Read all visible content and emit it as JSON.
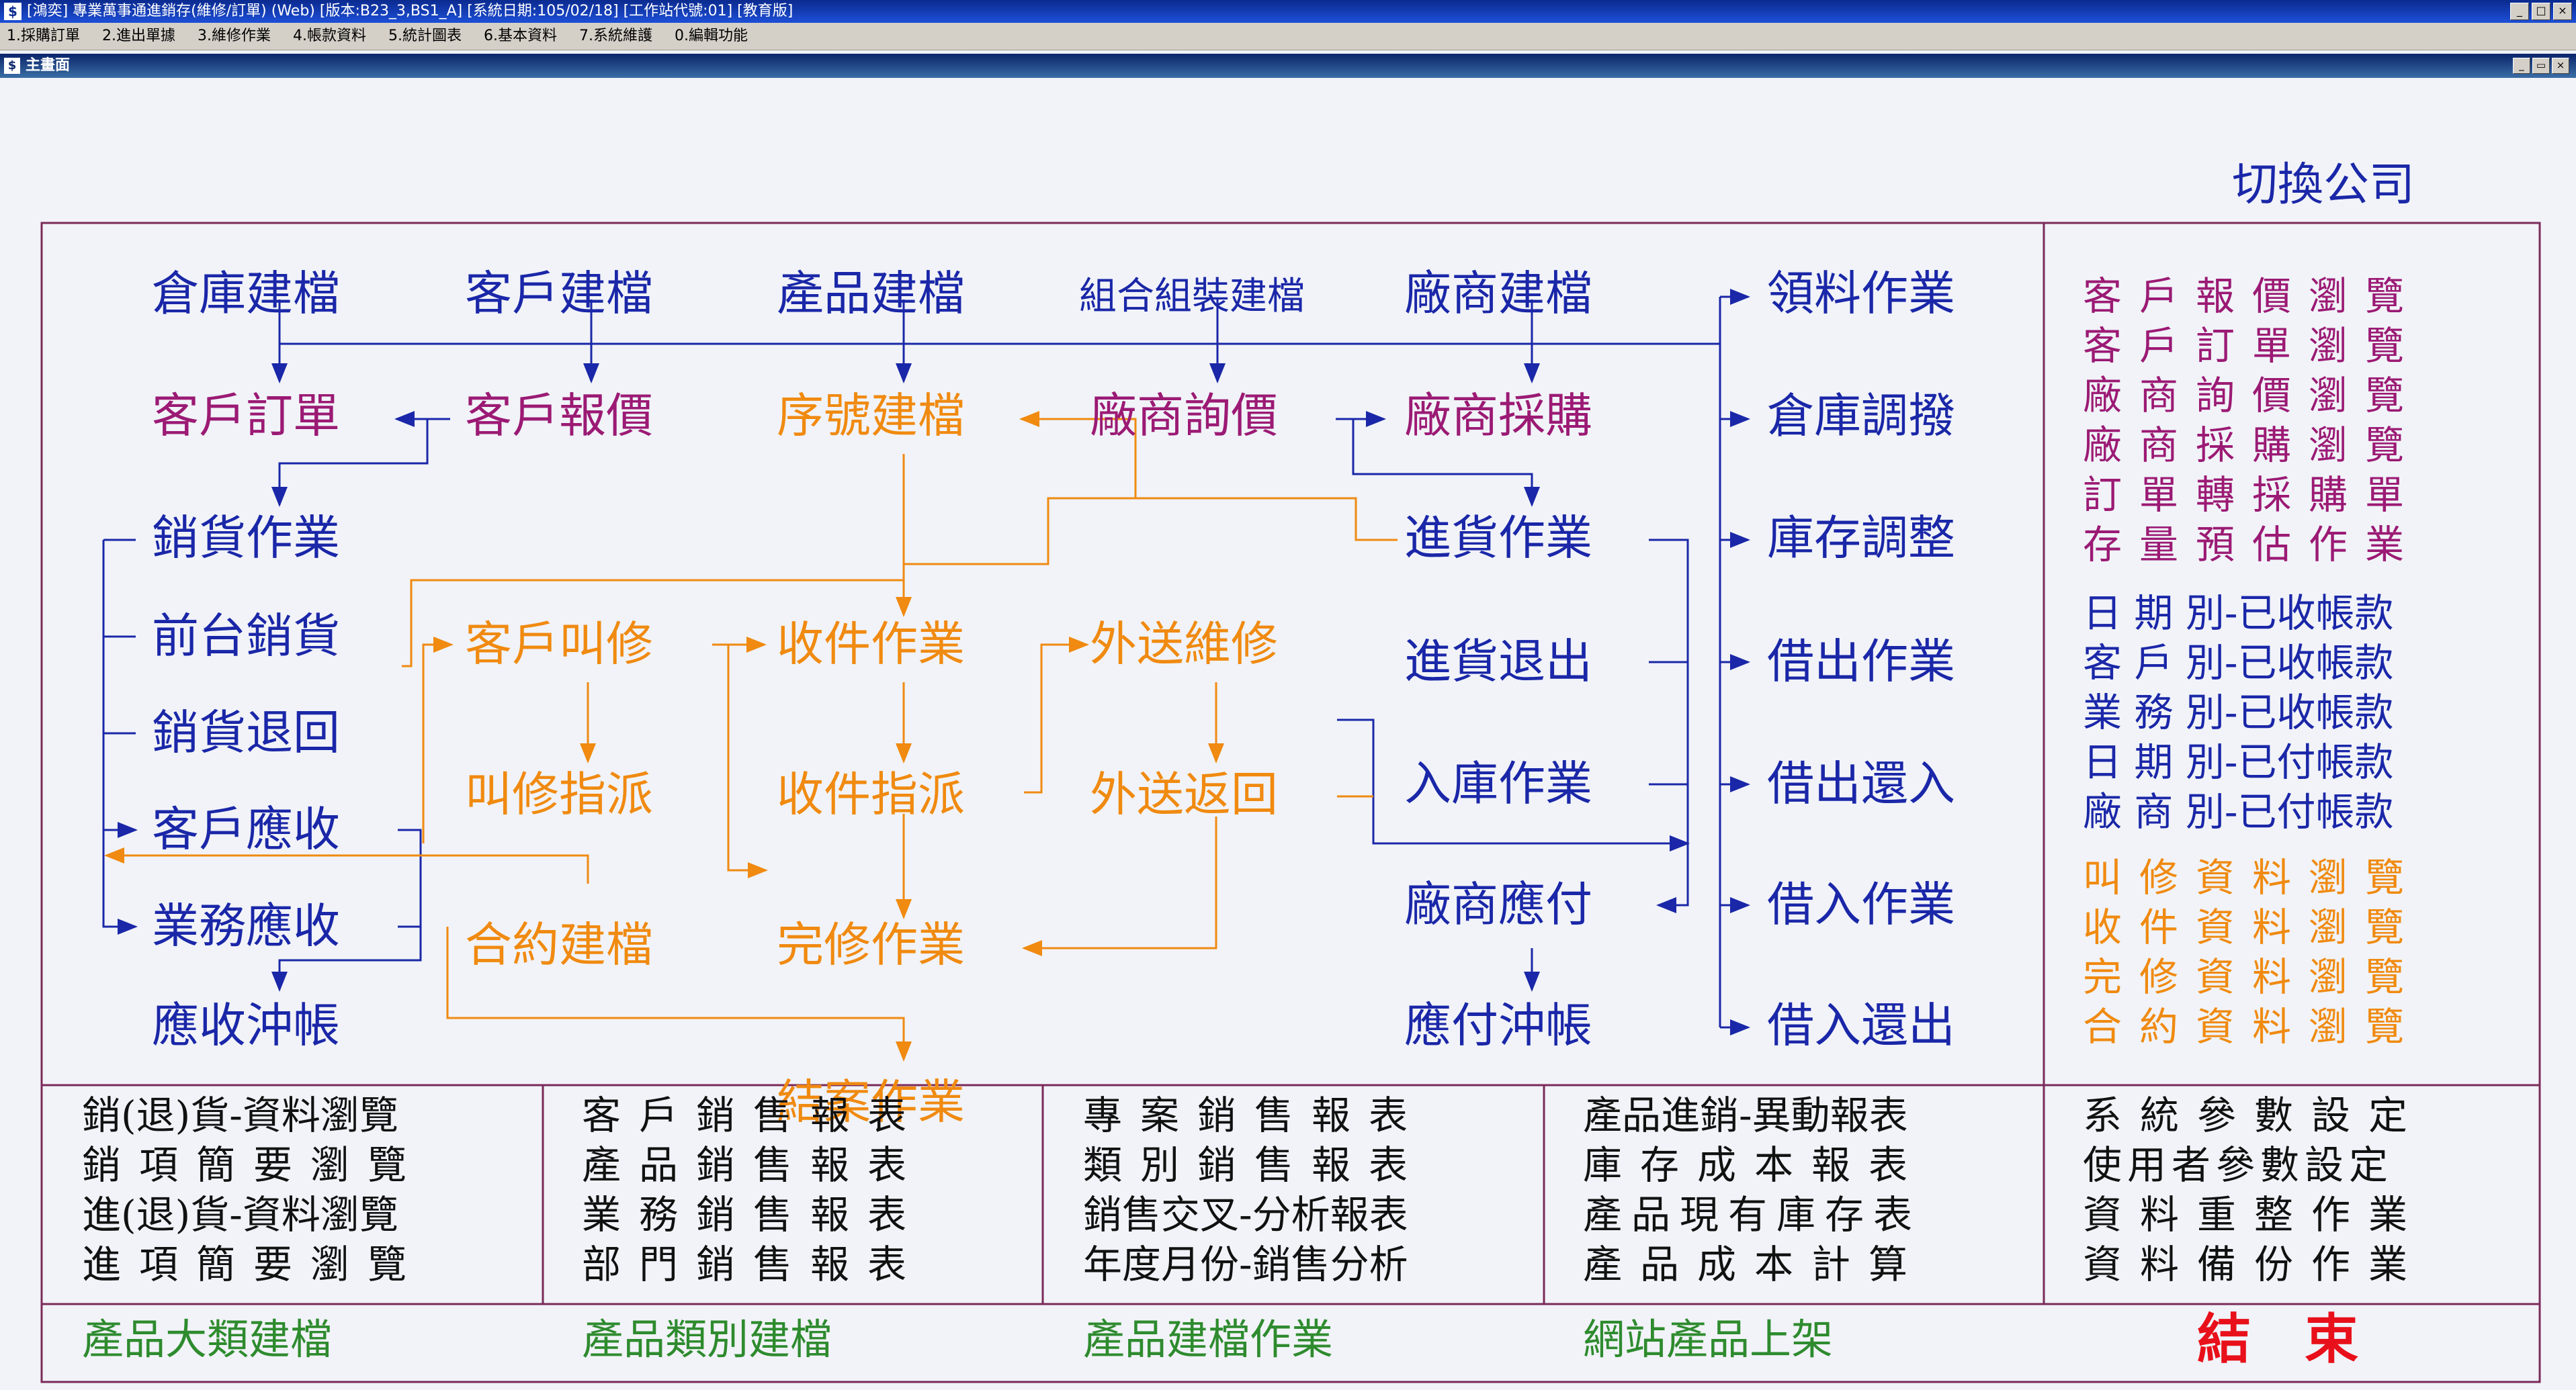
{
  "window": {
    "title": "[鴻奕] 專業萬事通進銷存(維修/訂單) (Web) [版本:B23_3,BS1_A] [系統日期:105/02/18] [工作站代號:01] [教育版]",
    "controls": [
      "_",
      "□",
      "×"
    ]
  },
  "menu": [
    "1.採購訂單",
    "2.進出單據",
    "3.維修作業",
    "4.帳款資料",
    "5.統計圖表",
    "6.基本資料",
    "7.系統維護",
    "0.編輯功能"
  ],
  "child_window": {
    "title": "主畫面",
    "controls": [
      "_",
      "▭",
      "×"
    ]
  },
  "switch_company": "切換公司",
  "flow": {
    "warehouse_setup": "倉庫建檔",
    "customer_setup": "客戶建檔",
    "product_setup": "產品建檔",
    "bundle_setup": "組合組裝建檔",
    "vendor_setup": "廠商建檔",
    "customer_order": "客戶訂單",
    "customer_quote": "客戶報價",
    "serial_setup": "序號建檔",
    "vendor_inquiry": "廠商詢價",
    "vendor_purchase": "廠商採購",
    "sales": "銷貨作業",
    "pos_sales": "前台銷貨",
    "sales_return": "銷貨退回",
    "accounts_receivable": "客戶應收",
    "sales_rep_receivable": "業務應收",
    "receivable_offset": "應收沖帳",
    "repair_call": "客戶叫修",
    "repair_dispatch": "叫修指派",
    "contract_setup": "合約建檔",
    "intake": "收件作業",
    "intake_dispatch": "收件指派",
    "repair_done": "完修作業",
    "case_close": "結案作業",
    "outsource_repair": "外送維修",
    "outsource_return": "外送返回",
    "purchase_in": "進貨作業",
    "purchase_return": "進貨退出",
    "stock_in": "入庫作業",
    "accounts_payable": "廠商應付",
    "payable_offset": "應付沖帳",
    "material_requisition": "領料作業",
    "warehouse_transfer": "倉庫調撥",
    "stock_adjust": "庫存調整",
    "lend_out": "借出作業",
    "lend_out_return": "借出還入",
    "borrow_in": "借入作業",
    "borrow_in_return": "借入還出"
  },
  "side_panel": {
    "browse_group": [
      "客戶報價瀏覽",
      "客戶訂單瀏覽",
      "廠商詢價瀏覽",
      "廠商採購瀏覽",
      "訂單轉採購單",
      "存量預估作業"
    ],
    "ledger_group": [
      "日 期 別-已收帳款",
      "客 戶 別-已收帳款",
      "業 務 別-已收帳款",
      "日 期 別-已付帳款",
      "廠 商 別-已付帳款"
    ],
    "repair_group": [
      "叫修資料瀏覽",
      "收件資料瀏覽",
      "完修資料瀏覽",
      "合約資料瀏覽"
    ]
  },
  "reports": {
    "col1": [
      "銷(退)貨-資料瀏覽",
      "銷項簡要瀏覽",
      "進(退)貨-資料瀏覽",
      "進項簡要瀏覽"
    ],
    "col2": [
      "客戶銷售報表",
      "產品銷售報表",
      "業務銷售報表",
      "部門銷售報表"
    ],
    "col3": [
      "專案銷售報表",
      "類別銷售報表",
      "銷售交叉-分析報表",
      "年度月份-銷售分析"
    ],
    "col4": [
      "產品進銷-異動報表",
      "庫存成本報表",
      "產品現有庫存表",
      "產品成本計算"
    ],
    "col5": [
      "系統參數設定",
      "使用者參數設定",
      "資料重整作業",
      "資料備份作業"
    ]
  },
  "bottom_flow": [
    "產品大類建檔",
    "產品類別建檔",
    "產品建檔作業",
    "網站產品上架"
  ],
  "exit": "結　束",
  "colors": {
    "navy": "#1a27a8",
    "orange": "#f08a10",
    "plum": "#9b1a74",
    "frame": "#7a2a5a",
    "red": "#e8101a",
    "green": "#2e8b2e"
  }
}
